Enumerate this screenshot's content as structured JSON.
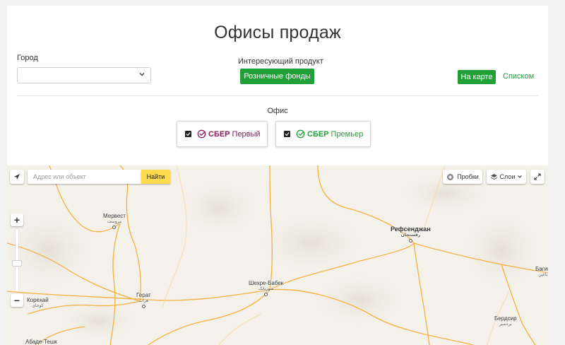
{
  "header": {
    "title": "Офисы продаж"
  },
  "filters": {
    "city_label": "Город",
    "city_value": "",
    "product_label": "Интересующий продукт",
    "product_button": "Розничные фонды",
    "view_map": "На карте",
    "view_list": "Списком"
  },
  "office": {
    "label": "Офис",
    "options": [
      {
        "brand": "СБЕР",
        "sub": "Первый",
        "checked": true,
        "color": "#8a1c5e"
      },
      {
        "brand": "СБЕР",
        "sub": "Премьер",
        "checked": true,
        "color": "#21a038"
      }
    ]
  },
  "map": {
    "search_placeholder": "Адрес или объект",
    "find_button": "Найти",
    "traffic_button": "Пробки",
    "layers_button": "Слои",
    "cities": [
      {
        "name": "Мервест",
        "native": "مروست"
      },
      {
        "name": "Рефсенджан",
        "native": "رفسنجان"
      },
      {
        "name": "Багин",
        "native": "باغین"
      },
      {
        "name": "Шехре-Бабек",
        "native": "شهربابک"
      },
      {
        "name": "Герат",
        "native": "هرات"
      },
      {
        "name": "Корехай",
        "native": "کوخای"
      },
      {
        "name": "Бердсир",
        "native": "بردسیر"
      },
      {
        "name": "Абаде-Тешк",
        "native": ""
      }
    ]
  },
  "colors": {
    "accent": "#21a038",
    "find": "#ffdb4d",
    "road": "#f5b041"
  }
}
